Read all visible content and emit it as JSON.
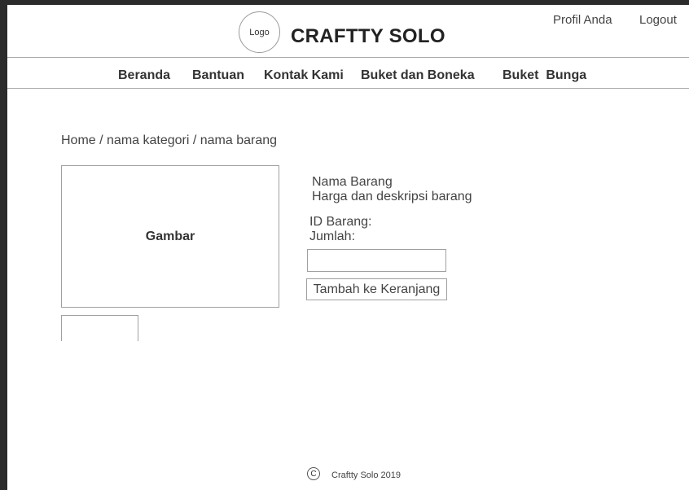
{
  "header": {
    "logo_text": "Logo",
    "site_title": "CRAFTTY SOLO",
    "profile_link": "Profil Anda",
    "logout_link": "Logout"
  },
  "nav": {
    "items": [
      {
        "label": "Beranda"
      },
      {
        "label": "Bantuan"
      },
      {
        "label": "Kontak Kami"
      },
      {
        "label": "Buket dan Boneka"
      },
      {
        "label": "Buket  Bunga"
      }
    ]
  },
  "breadcrumb": "Home / nama kategori / nama barang",
  "product": {
    "image_label": "Gambar",
    "name": "Nama Barang",
    "price_desc": "Harga dan deskripsi barang",
    "id_label": "ID Barang:",
    "qty_label": "Jumlah:",
    "qty_value": "",
    "add_button": "Tambah ke Keranjang"
  },
  "footer": {
    "copyright_symbol": "C",
    "text": "Craftty Solo 2019"
  }
}
